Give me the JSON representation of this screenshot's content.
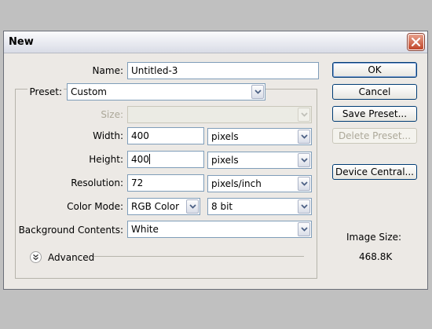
{
  "dialog": {
    "title": "New"
  },
  "name": {
    "label": "Name:",
    "value": "Untitled-3"
  },
  "preset": {
    "label": "Preset:",
    "value": "Custom"
  },
  "size": {
    "label": "Size:",
    "value": ""
  },
  "width": {
    "label": "Width:",
    "value": "400",
    "unit": "pixels"
  },
  "height": {
    "label": "Height:",
    "value": "400",
    "unit": "pixels"
  },
  "resolution": {
    "label": "Resolution:",
    "value": "72",
    "unit": "pixels/inch"
  },
  "color_mode": {
    "label": "Color Mode:",
    "value": "RGB Color",
    "depth": "8 bit"
  },
  "background": {
    "label": "Background Contents:",
    "value": "White"
  },
  "advanced": {
    "label": "Advanced"
  },
  "buttons": {
    "ok": "OK",
    "cancel": "Cancel",
    "save_preset": "Save Preset...",
    "delete_preset": "Delete Preset...",
    "device_central": "Device Central..."
  },
  "image_size": {
    "label": "Image Size:",
    "value": "468.8K"
  },
  "colors": {
    "close": "#c0462a",
    "button_border": "#003c74",
    "field_border": "#7f9db9"
  }
}
